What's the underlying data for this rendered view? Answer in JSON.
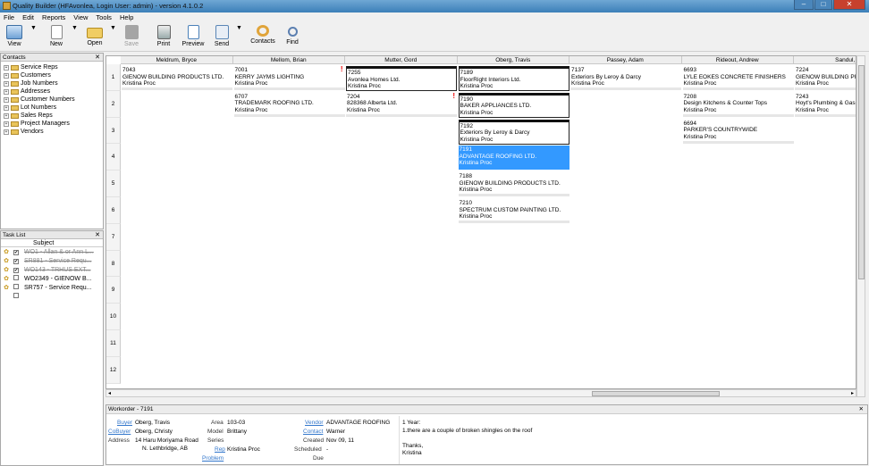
{
  "window": {
    "title": "Quality Builder (HFAvonlea, Login User: admin) - version 4.1.0.2"
  },
  "menu": [
    "File",
    "Edit",
    "Reports",
    "View",
    "Tools",
    "Help"
  ],
  "toolbar": {
    "view": "View",
    "new": "New",
    "open": "Open",
    "save": "Save",
    "print": "Print",
    "preview": "Preview",
    "send": "Send",
    "contacts": "Contacts",
    "find": "Find"
  },
  "contacts_panel": {
    "title": "Contacts",
    "items": [
      "Service Reps",
      "Customers",
      "Job Numbers",
      "Addresses",
      "Customer Numbers",
      "Lot Numbers",
      "Sales Reps",
      "Project Managers",
      "Vendors"
    ]
  },
  "task_list": {
    "title": "Task List",
    "column": "Subject",
    "tasks": [
      {
        "subject": "WO1 - Allan & or Ann L...",
        "checked": true,
        "done": true
      },
      {
        "subject": "SR881 - Service Requ...",
        "checked": true,
        "done": true
      },
      {
        "subject": "WO143 - TRHUS EXT...",
        "checked": true,
        "done": true
      },
      {
        "subject": "WO2349 - GIENOW B...",
        "checked": false,
        "done": false
      },
      {
        "subject": "SR757 - Service Requ...",
        "checked": false,
        "done": false
      }
    ]
  },
  "grid": {
    "columns": [
      "Meldrum, Bryce",
      "Mellom, Brian",
      "Mutter, Gord",
      "Oberg, Travis",
      "Passey, Adam",
      "Rideout, Andrew",
      "Sandul, De"
    ],
    "rows": [
      "1",
      "2",
      "3",
      "4",
      "5",
      "6",
      "7",
      "8",
      "9",
      "10",
      "11",
      "12"
    ],
    "cards": [
      {
        "col": 0,
        "row": 0,
        "num": "7043",
        "name": "GIENOW BUILDING PRODUCTS LTD.",
        "rep": "Kristina Proc"
      },
      {
        "col": 1,
        "row": 0,
        "num": "7001",
        "name": "KERRY JAYMS LIGHTING",
        "rep": "Kristina Proc",
        "flag": true
      },
      {
        "col": 2,
        "row": 0,
        "num": "7255",
        "name": "Avonlea Homes Ltd.",
        "rep": "Kristina Proc",
        "boxed": true
      },
      {
        "col": 3,
        "row": 0,
        "num": "7189",
        "name": "FloorRight Interiors Ltd.",
        "rep": "Kristina Proc",
        "boxed": true
      },
      {
        "col": 4,
        "row": 0,
        "num": "7137",
        "name": "Exteriors By Leroy & Darcy",
        "rep": "Kristina Proc"
      },
      {
        "col": 5,
        "row": 0,
        "num": "6693",
        "name": "LYLE EOKES CONCRETE FINISHERS",
        "rep": "Kristina Proc"
      },
      {
        "col": 6,
        "row": 0,
        "num": "7224",
        "name": "GIENOW BUILDING PR",
        "rep": "Kristina Proc"
      },
      {
        "col": 1,
        "row": 1,
        "num": "6707",
        "name": "TRADEMARK ROOFING LTD.",
        "rep": "Kristina Proc"
      },
      {
        "col": 2,
        "row": 1,
        "num": "7204",
        "name": "828368 Alberta Ltd.",
        "rep": "Kristina Proc",
        "flag": true
      },
      {
        "col": 3,
        "row": 1,
        "num": "7190",
        "name": "BAKER APPLIANCES LTD.",
        "rep": "Kristina Proc",
        "boxed": true
      },
      {
        "col": 5,
        "row": 1,
        "num": "7208",
        "name": "Design Kitchens & Counter Tops",
        "rep": "Kristina Proc"
      },
      {
        "col": 6,
        "row": 1,
        "num": "7243",
        "name": "Hoyt's Plumbing & Gas",
        "rep": "Kristina Proc"
      },
      {
        "col": 3,
        "row": 2,
        "num": "7192",
        "name": "Exteriors By Leroy & Darcy",
        "rep": "Kristina Proc",
        "boxed": true
      },
      {
        "col": 5,
        "row": 2,
        "num": "6694",
        "name": "PARKER'S COUNTRYWIDE",
        "rep": "Kristina Proc"
      },
      {
        "col": 3,
        "row": 3,
        "num": "7191",
        "name": "ADVANTAGE ROOFING LTD.",
        "rep": "Kristina Proc",
        "selected": true
      },
      {
        "col": 3,
        "row": 4,
        "num": "7188",
        "name": "GIENOW BUILDING PRODUCTS LTD.",
        "rep": "Kristina Proc"
      },
      {
        "col": 3,
        "row": 5,
        "num": "7210",
        "name": "SPECTRUM CUSTOM PAINTING LTD.",
        "rep": "Kristina Proc"
      }
    ]
  },
  "workorder": {
    "title": "Workorder - 7191",
    "buyer_label": "Buyer",
    "buyer": "Oberg, Travis",
    "cobuyer_label": "CoBuyer",
    "cobuyer": "Oberg, Christy",
    "address_label": "Address",
    "address1": "14 Haru Moriyama Road",
    "address2": "N.  Lethbridge, AB",
    "area_label": "Area",
    "area": "103-03",
    "model_label": "Model",
    "model": "Brittany",
    "series_label": "Series",
    "series": "",
    "rep_label": "Rep",
    "rep": "Kristina Proc",
    "problem_label": "Problem",
    "vendor_label": "Vendor",
    "vendor": "ADVANTAGE ROOFING",
    "contact_label": "Contact",
    "contact": "Warner",
    "created_label": "Created",
    "created": "Nov 09, 11",
    "scheduled_label": "Scheduled",
    "scheduled": "-",
    "due_label": "Due",
    "due": "",
    "notes": [
      "1 Year:",
      "1.there are a couple of broken shingles on the roof",
      "",
      "Thanks,",
      "Kristina"
    ]
  }
}
